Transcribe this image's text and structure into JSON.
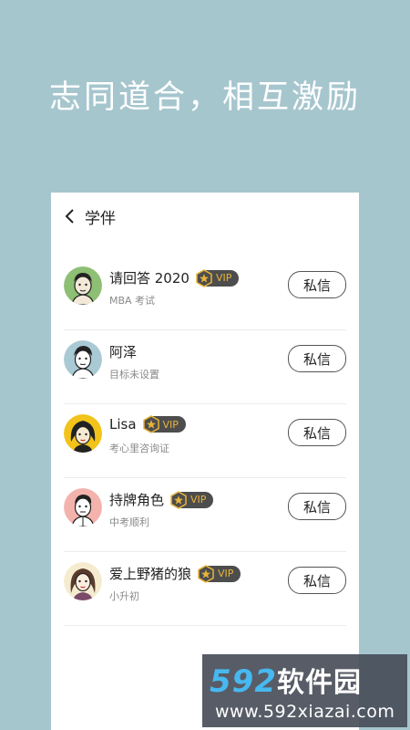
{
  "headline": "志同道合，相互激励",
  "header": {
    "title": "学伴"
  },
  "vip_label": "VIP",
  "message_label": "私信",
  "partners": [
    {
      "name": "请回答 2020",
      "subtitle": "MBA 考试",
      "vip": true,
      "avatar": "avatar-green"
    },
    {
      "name": "阿泽",
      "subtitle": "目标未设置",
      "vip": false,
      "avatar": "avatar-blue"
    },
    {
      "name": "Lisa",
      "subtitle": "考心里咨询证",
      "vip": true,
      "avatar": "avatar-yellow"
    },
    {
      "name": "持牌角色",
      "subtitle": "中考顺利",
      "vip": true,
      "avatar": "avatar-pink"
    },
    {
      "name": "爱上野猪的狼",
      "subtitle": "小升初",
      "vip": true,
      "avatar": "avatar-cream"
    }
  ],
  "watermark": {
    "brand_num": "592",
    "brand_cn": "软件园",
    "url": "www.592xiazai.com"
  },
  "colors": {
    "background": "#a6c6ce",
    "vip_gold": "#e8b43a",
    "vip_dark": "#4d4d4d",
    "brand_blue": "#47b8f0"
  }
}
